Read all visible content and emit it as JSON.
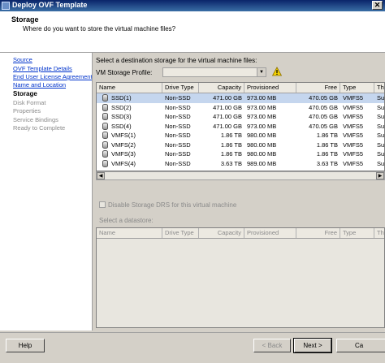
{
  "window": {
    "title": "Deploy OVF Template",
    "close": "✕"
  },
  "header": {
    "title": "Storage",
    "subtitle": "Where do you want to store the virtual machine files?"
  },
  "nav": [
    {
      "label": "Source",
      "state": "link"
    },
    {
      "label": "OVF Template Details",
      "state": "link"
    },
    {
      "label": "End User License Agreement",
      "state": "link"
    },
    {
      "label": "Name and Location",
      "state": "link"
    },
    {
      "label": "Storage",
      "state": "current"
    },
    {
      "label": "Disk Format",
      "state": "disabled"
    },
    {
      "label": "Properties",
      "state": "disabled"
    },
    {
      "label": "Service Bindings",
      "state": "disabled"
    },
    {
      "label": "Ready to Complete",
      "state": "disabled"
    }
  ],
  "main": {
    "instruction": "Select a destination storage for the virtual machine files:",
    "vm_profile_label": "VM Storage Profile:",
    "vm_profile_value": ""
  },
  "table": {
    "columns": [
      "Name",
      "Drive Type",
      "Capacity",
      "Provisioned",
      "Free",
      "Type",
      "Thin Provi"
    ],
    "rows": [
      [
        "SSD(1)",
        "Non-SSD",
        "471.00 GB",
        "973.00 MB",
        "470.05 GB",
        "VMFS5",
        "Supporte"
      ],
      [
        "SSD(2)",
        "Non-SSD",
        "471.00 GB",
        "973.00 MB",
        "470.05 GB",
        "VMFS5",
        "Supporte"
      ],
      [
        "SSD(3)",
        "Non-SSD",
        "471.00 GB",
        "973.00 MB",
        "470.05 GB",
        "VMFS5",
        "Supporte"
      ],
      [
        "SSD(4)",
        "Non-SSD",
        "471.00 GB",
        "973.00 MB",
        "470.05 GB",
        "VMFS5",
        "Supporte"
      ],
      [
        "VMFS(1)",
        "Non-SSD",
        "1.86 TB",
        "980.00 MB",
        "1.86 TB",
        "VMFS5",
        "Supporte"
      ],
      [
        "VMFS(2)",
        "Non-SSD",
        "1.86 TB",
        "980.00 MB",
        "1.86 TB",
        "VMFS5",
        "Supporte"
      ],
      [
        "VMFS(3)",
        "Non-SSD",
        "1.86 TB",
        "980.00 MB",
        "1.86 TB",
        "VMFS5",
        "Supporte"
      ],
      [
        "VMFS(4)",
        "Non-SSD",
        "3.63 TB",
        "989.00 MB",
        "3.63 TB",
        "VMFS5",
        "Supporte"
      ]
    ],
    "selected_row": 0
  },
  "drs_checkbox_label": "Disable Storage DRS for this virtual machine",
  "datastore_label": "Select a datastore:",
  "table2": {
    "columns": [
      "Name",
      "Drive Type",
      "Capacity",
      "Provisioned",
      "Free",
      "Type",
      "Thin Provi"
    ]
  },
  "buttons": {
    "help": "Help",
    "back": "< Back",
    "next": "Next >",
    "cancel": "Ca"
  },
  "colors": {
    "accent": "#0a246a",
    "selection": "#c5d6ee",
    "link": "#0033cc"
  }
}
